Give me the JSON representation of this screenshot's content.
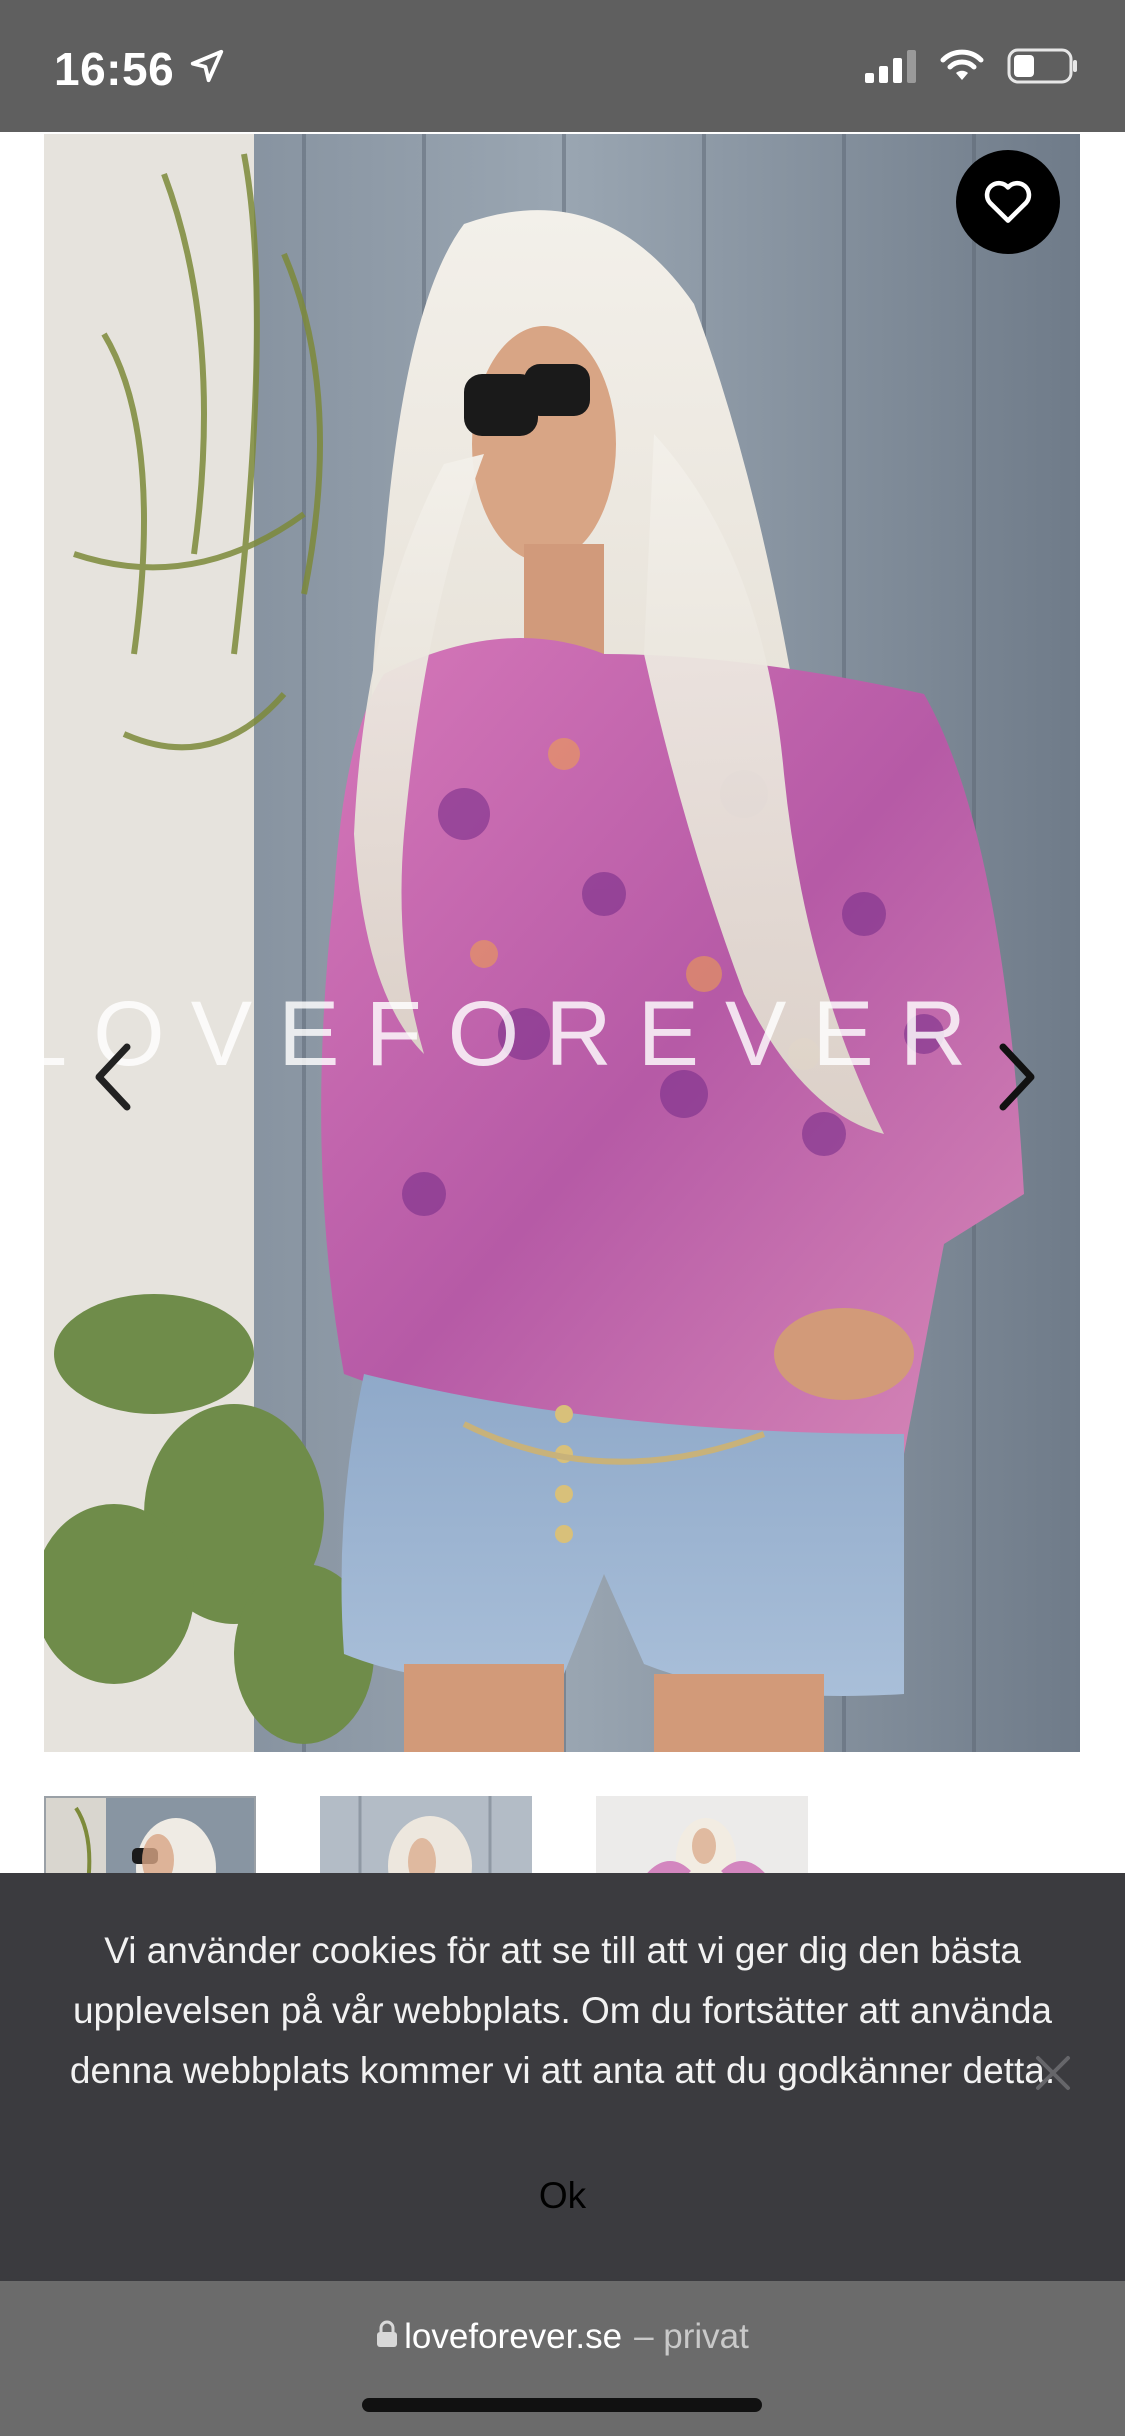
{
  "status_bar": {
    "time": "16:56",
    "location_icon": "location-arrow-icon",
    "signal_icon": "cellular-signal-icon",
    "wifi_icon": "wifi-icon",
    "battery_icon": "battery-icon"
  },
  "product": {
    "watermark": "LOVEFOREVER",
    "favorite_icon": "heart-icon",
    "prev_icon": "chevron-left-icon",
    "next_icon": "chevron-right-icon"
  },
  "cookie_banner": {
    "message": "Vi använder cookies för att se till att vi ger dig den bästa upplevelsen på vår webbplats. Om du fortsätter att använda denna webbplats kommer vi att anta att du godkänner detta.",
    "ok_label": "Ok",
    "close_icon": "close-icon"
  },
  "browser": {
    "domain": "loveforever.se",
    "mode": "– privat",
    "lock_icon": "lock-icon"
  },
  "colors": {
    "status_bar": "#5f5f5f",
    "banner_bg": "#3b3b3f",
    "url_bar": "#6b6b6b"
  }
}
